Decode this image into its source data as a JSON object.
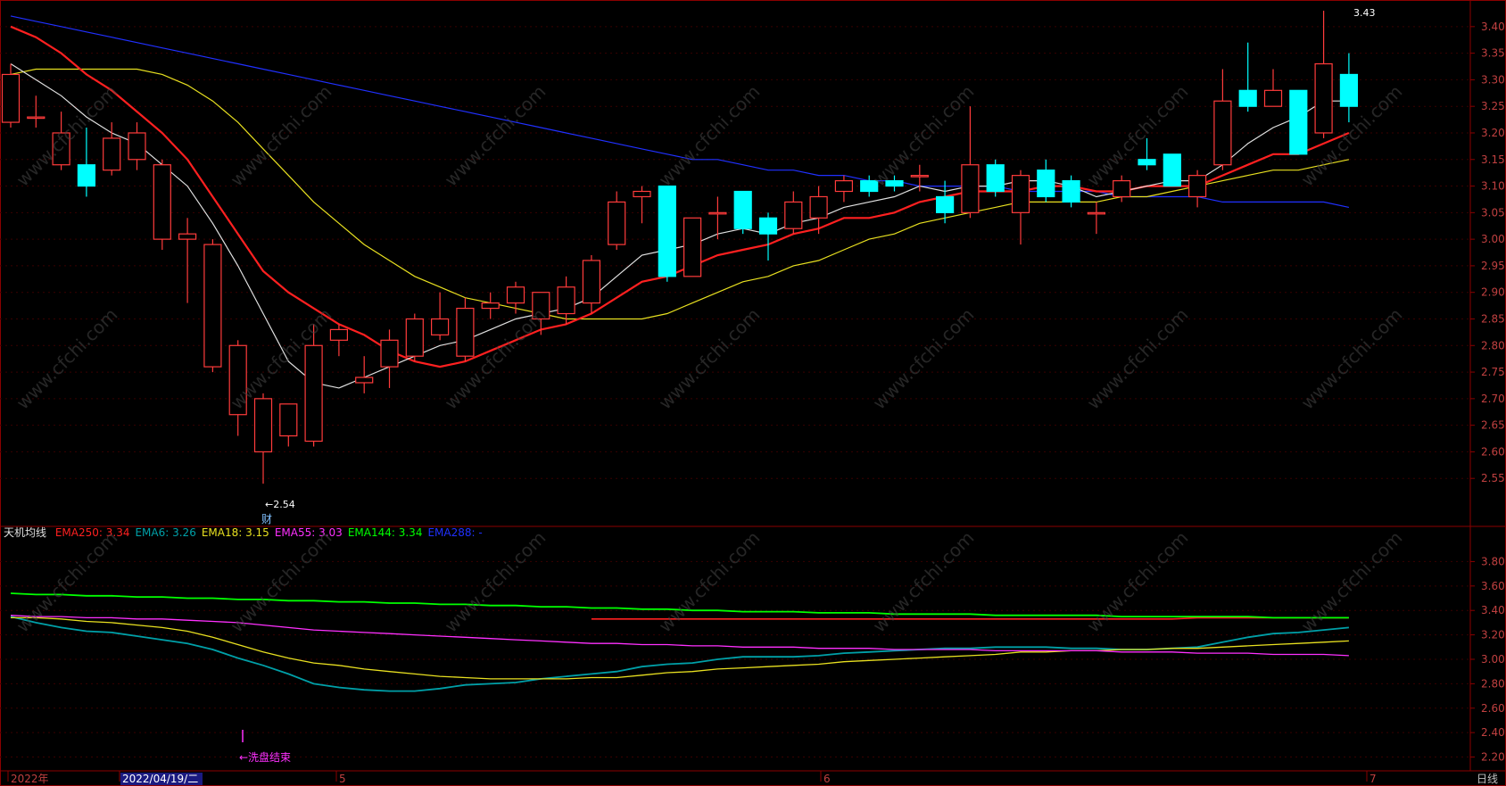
{
  "colors": {
    "background": "#000000",
    "frame": "#8b0000",
    "up_candle": "#ff3b3b",
    "down_candle": "#00ffff",
    "ema250": "#ff2020",
    "ema6": "#00a0a8",
    "ema18": "#e8e020",
    "ema55": "#ff30ff",
    "ema144": "#00ff00",
    "ema288": "#2030ff",
    "white_ma": "#e0e0e0"
  },
  "watermark": "www.cfchi.com",
  "main_chart": {
    "y_ticks": [
      "3.40",
      "3.35",
      "3.30",
      "3.25",
      "3.20",
      "3.15",
      "3.10",
      "3.05",
      "3.00",
      "2.95",
      "2.90",
      "2.85",
      "2.80",
      "2.75",
      "2.70",
      "2.65",
      "2.60",
      "2.55"
    ],
    "high_label": "3.43",
    "low_label": "←2.54",
    "low_marker": "财"
  },
  "indicator": {
    "name": "天机均线",
    "legend": [
      {
        "label": "EMA250:",
        "value": "3.34",
        "color": "#ff2020"
      },
      {
        "label": "EMA6:",
        "value": "3.26",
        "color": "#00a0a8"
      },
      {
        "label": "EMA18:",
        "value": "3.15",
        "color": "#e8e020"
      },
      {
        "label": "EMA55:",
        "value": "3.03",
        "color": "#ff30ff"
      },
      {
        "label": "EMA144:",
        "value": "3.34",
        "color": "#00ff00"
      },
      {
        "label": "EMA288:",
        "value": "-",
        "color": "#2030ff"
      }
    ],
    "y_ticks": [
      "3.80",
      "3.60",
      "3.40",
      "3.20",
      "3.00",
      "2.80",
      "2.60",
      "2.40",
      "2.20"
    ],
    "signal_label": "←洗盘结束"
  },
  "x_axis": {
    "labels": [
      "2022年",
      "2022/04/19/二",
      "5",
      "6",
      "7"
    ],
    "period": "日线"
  },
  "chart_data": [
    {
      "type": "candlestick",
      "ylim": [
        2.5,
        3.44
      ],
      "candles": [
        {
          "o": 3.22,
          "h": 3.33,
          "l": 3.21,
          "c": 3.31
        },
        {
          "o": 3.23,
          "h": 3.27,
          "l": 3.21,
          "c": 3.23
        },
        {
          "o": 3.14,
          "h": 3.24,
          "l": 3.13,
          "c": 3.2
        },
        {
          "o": 3.14,
          "h": 3.21,
          "l": 3.08,
          "c": 3.1
        },
        {
          "o": 3.13,
          "h": 3.22,
          "l": 3.12,
          "c": 3.19
        },
        {
          "o": 3.15,
          "h": 3.22,
          "l": 3.13,
          "c": 3.2
        },
        {
          "o": 3.0,
          "h": 3.15,
          "l": 2.98,
          "c": 3.14
        },
        {
          "o": 3.0,
          "h": 3.04,
          "l": 2.88,
          "c": 3.01
        },
        {
          "o": 2.76,
          "h": 3.0,
          "l": 2.75,
          "c": 2.99
        },
        {
          "o": 2.67,
          "h": 2.81,
          "l": 2.63,
          "c": 2.8
        },
        {
          "o": 2.6,
          "h": 2.71,
          "l": 2.54,
          "c": 2.7
        },
        {
          "o": 2.63,
          "h": 2.69,
          "l": 2.61,
          "c": 2.69
        },
        {
          "o": 2.62,
          "h": 2.84,
          "l": 2.61,
          "c": 2.8
        },
        {
          "o": 2.81,
          "h": 2.84,
          "l": 2.78,
          "c": 2.83
        },
        {
          "o": 2.73,
          "h": 2.78,
          "l": 2.71,
          "c": 2.74
        },
        {
          "o": 2.76,
          "h": 2.83,
          "l": 2.72,
          "c": 2.81
        },
        {
          "o": 2.78,
          "h": 2.86,
          "l": 2.77,
          "c": 2.85
        },
        {
          "o": 2.82,
          "h": 2.9,
          "l": 2.81,
          "c": 2.85
        },
        {
          "o": 2.78,
          "h": 2.89,
          "l": 2.77,
          "c": 2.87
        },
        {
          "o": 2.87,
          "h": 2.9,
          "l": 2.85,
          "c": 2.88
        },
        {
          "o": 2.88,
          "h": 2.92,
          "l": 2.86,
          "c": 2.91
        },
        {
          "o": 2.85,
          "h": 2.9,
          "l": 2.82,
          "c": 2.9
        },
        {
          "o": 2.86,
          "h": 2.93,
          "l": 2.84,
          "c": 2.91
        },
        {
          "o": 2.88,
          "h": 2.97,
          "l": 2.86,
          "c": 2.96
        },
        {
          "o": 2.99,
          "h": 3.09,
          "l": 2.98,
          "c": 3.07
        },
        {
          "o": 3.08,
          "h": 3.1,
          "l": 3.03,
          "c": 3.09
        },
        {
          "o": 3.1,
          "h": 3.1,
          "l": 2.92,
          "c": 2.93
        },
        {
          "o": 2.93,
          "h": 3.04,
          "l": 2.93,
          "c": 3.04
        },
        {
          "o": 3.05,
          "h": 3.08,
          "l": 3.0,
          "c": 3.05
        },
        {
          "o": 3.09,
          "h": 3.09,
          "l": 3.01,
          "c": 3.02
        },
        {
          "o": 3.04,
          "h": 3.05,
          "l": 2.96,
          "c": 3.01
        },
        {
          "o": 3.02,
          "h": 3.09,
          "l": 3.01,
          "c": 3.07
        },
        {
          "o": 3.04,
          "h": 3.1,
          "l": 3.01,
          "c": 3.08
        },
        {
          "o": 3.09,
          "h": 3.12,
          "l": 3.07,
          "c": 3.11
        },
        {
          "o": 3.11,
          "h": 3.12,
          "l": 3.08,
          "c": 3.09
        },
        {
          "o": 3.11,
          "h": 3.12,
          "l": 3.09,
          "c": 3.1
        },
        {
          "o": 3.12,
          "h": 3.14,
          "l": 3.09,
          "c": 3.12
        },
        {
          "o": 3.08,
          "h": 3.11,
          "l": 3.03,
          "c": 3.05
        },
        {
          "o": 3.05,
          "h": 3.25,
          "l": 3.04,
          "c": 3.14
        },
        {
          "o": 3.14,
          "h": 3.15,
          "l": 3.08,
          "c": 3.09
        },
        {
          "o": 3.05,
          "h": 3.13,
          "l": 2.99,
          "c": 3.12
        },
        {
          "o": 3.13,
          "h": 3.15,
          "l": 3.07,
          "c": 3.08
        },
        {
          "o": 3.11,
          "h": 3.12,
          "l": 3.06,
          "c": 3.07
        },
        {
          "o": 3.05,
          "h": 3.07,
          "l": 3.01,
          "c": 3.05
        },
        {
          "o": 3.08,
          "h": 3.12,
          "l": 3.07,
          "c": 3.11
        },
        {
          "o": 3.15,
          "h": 3.19,
          "l": 3.13,
          "c": 3.14
        },
        {
          "o": 3.16,
          "h": 3.16,
          "l": 3.1,
          "c": 3.1
        },
        {
          "o": 3.08,
          "h": 3.13,
          "l": 3.06,
          "c": 3.12
        },
        {
          "o": 3.14,
          "h": 3.32,
          "l": 3.13,
          "c": 3.26
        },
        {
          "o": 3.28,
          "h": 3.37,
          "l": 3.24,
          "c": 3.25
        },
        {
          "o": 3.25,
          "h": 3.32,
          "l": 3.25,
          "c": 3.28
        },
        {
          "o": 3.28,
          "h": 3.28,
          "l": 3.16,
          "c": 3.16
        },
        {
          "o": 3.2,
          "h": 3.43,
          "l": 3.19,
          "c": 3.33
        },
        {
          "o": 3.31,
          "h": 3.35,
          "l": 3.22,
          "c": 3.25
        }
      ],
      "ma_white": [
        3.33,
        3.3,
        3.27,
        3.23,
        3.2,
        3.18,
        3.14,
        3.1,
        3.03,
        2.95,
        2.86,
        2.77,
        2.73,
        2.72,
        2.74,
        2.76,
        2.78,
        2.8,
        2.81,
        2.83,
        2.85,
        2.86,
        2.87,
        2.89,
        2.93,
        2.97,
        2.98,
        2.99,
        3.01,
        3.02,
        3.01,
        3.03,
        3.04,
        3.06,
        3.07,
        3.08,
        3.1,
        3.09,
        3.1,
        3.1,
        3.11,
        3.11,
        3.1,
        3.08,
        3.09,
        3.1,
        3.11,
        3.11,
        3.14,
        3.18,
        3.21,
        3.23,
        3.26,
        3.26
      ],
      "ma_red": [
        3.4,
        3.38,
        3.35,
        3.31,
        3.28,
        3.24,
        3.2,
        3.15,
        3.08,
        3.01,
        2.94,
        2.9,
        2.87,
        2.84,
        2.82,
        2.79,
        2.77,
        2.76,
        2.77,
        2.79,
        2.81,
        2.83,
        2.84,
        2.86,
        2.89,
        2.92,
        2.93,
        2.95,
        2.97,
        2.98,
        2.99,
        3.01,
        3.02,
        3.04,
        3.04,
        3.05,
        3.07,
        3.08,
        3.09,
        3.09,
        3.09,
        3.1,
        3.1,
        3.09,
        3.09,
        3.1,
        3.1,
        3.1,
        3.12,
        3.14,
        3.16,
        3.16,
        3.18,
        3.2
      ],
      "ma_yellow": [
        3.31,
        3.32,
        3.32,
        3.32,
        3.32,
        3.32,
        3.31,
        3.29,
        3.26,
        3.22,
        3.17,
        3.12,
        3.07,
        3.03,
        2.99,
        2.96,
        2.93,
        2.91,
        2.89,
        2.88,
        2.87,
        2.86,
        2.85,
        2.85,
        2.85,
        2.85,
        2.86,
        2.88,
        2.9,
        2.92,
        2.93,
        2.95,
        2.96,
        2.98,
        3.0,
        3.01,
        3.03,
        3.04,
        3.05,
        3.06,
        3.07,
        3.07,
        3.07,
        3.07,
        3.08,
        3.08,
        3.09,
        3.1,
        3.11,
        3.12,
        3.13,
        3.13,
        3.14,
        3.15
      ],
      "ma_blue": [
        3.42,
        3.41,
        3.4,
        3.39,
        3.38,
        3.37,
        3.36,
        3.35,
        3.34,
        3.33,
        3.32,
        3.31,
        3.3,
        3.29,
        3.28,
        3.27,
        3.26,
        3.25,
        3.24,
        3.23,
        3.22,
        3.21,
        3.2,
        3.19,
        3.18,
        3.17,
        3.16,
        3.15,
        3.15,
        3.14,
        3.13,
        3.13,
        3.12,
        3.12,
        3.11,
        3.11,
        3.1,
        3.1,
        3.1,
        3.1,
        3.09,
        3.09,
        3.09,
        3.09,
        3.08,
        3.08,
        3.08,
        3.08,
        3.07,
        3.07,
        3.07,
        3.07,
        3.07,
        3.06
      ]
    },
    {
      "type": "line",
      "ylim": [
        2.16,
        3.92
      ],
      "series": [
        {
          "name": "EMA250",
          "start": 23,
          "values": [
            3.33,
            3.33,
            3.33,
            3.33,
            3.33,
            3.33,
            3.33,
            3.33,
            3.33,
            3.33,
            3.33,
            3.33,
            3.33,
            3.33,
            3.33,
            3.33,
            3.33,
            3.33,
            3.33,
            3.33,
            3.33,
            3.33,
            3.33,
            3.33,
            3.34,
            3.34,
            3.34,
            3.34,
            3.34,
            3.34,
            3.34
          ]
        },
        {
          "name": "EMA6",
          "start": 0,
          "values": [
            3.35,
            3.3,
            3.26,
            3.23,
            3.22,
            3.19,
            3.16,
            3.13,
            3.08,
            3.01,
            2.95,
            2.88,
            2.8,
            2.77,
            2.75,
            2.74,
            2.74,
            2.76,
            2.79,
            2.8,
            2.81,
            2.84,
            2.86,
            2.88,
            2.9,
            2.94,
            2.96,
            2.97,
            3.0,
            3.02,
            3.02,
            3.02,
            3.03,
            3.05,
            3.06,
            3.07,
            3.08,
            3.09,
            3.09,
            3.1,
            3.1,
            3.1,
            3.09,
            3.09,
            3.08,
            3.08,
            3.09,
            3.1,
            3.14,
            3.18,
            3.21,
            3.22,
            3.24,
            3.26
          ]
        },
        {
          "name": "EMA18",
          "start": 0,
          "values": [
            3.34,
            3.34,
            3.33,
            3.31,
            3.3,
            3.28,
            3.26,
            3.23,
            3.18,
            3.12,
            3.06,
            3.01,
            2.97,
            2.95,
            2.92,
            2.9,
            2.88,
            2.86,
            2.85,
            2.84,
            2.84,
            2.84,
            2.84,
            2.85,
            2.85,
            2.87,
            2.89,
            2.9,
            2.92,
            2.93,
            2.94,
            2.95,
            2.96,
            2.98,
            2.99,
            3.0,
            3.01,
            3.02,
            3.03,
            3.04,
            3.06,
            3.06,
            3.07,
            3.07,
            3.08,
            3.08,
            3.09,
            3.09,
            3.1,
            3.11,
            3.12,
            3.13,
            3.14,
            3.15
          ]
        },
        {
          "name": "EMA55",
          "start": 0,
          "values": [
            3.36,
            3.35,
            3.35,
            3.34,
            3.34,
            3.33,
            3.33,
            3.32,
            3.31,
            3.3,
            3.28,
            3.26,
            3.24,
            3.23,
            3.22,
            3.21,
            3.2,
            3.19,
            3.18,
            3.17,
            3.16,
            3.15,
            3.14,
            3.13,
            3.13,
            3.12,
            3.12,
            3.11,
            3.11,
            3.1,
            3.1,
            3.1,
            3.09,
            3.09,
            3.09,
            3.08,
            3.08,
            3.08,
            3.08,
            3.07,
            3.07,
            3.07,
            3.07,
            3.07,
            3.06,
            3.06,
            3.06,
            3.05,
            3.05,
            3.05,
            3.04,
            3.04,
            3.04,
            3.03
          ]
        },
        {
          "name": "EMA144",
          "start": 0,
          "values": [
            3.54,
            3.53,
            3.53,
            3.52,
            3.52,
            3.51,
            3.51,
            3.5,
            3.5,
            3.49,
            3.49,
            3.48,
            3.48,
            3.47,
            3.47,
            3.46,
            3.46,
            3.45,
            3.45,
            3.44,
            3.44,
            3.43,
            3.43,
            3.42,
            3.42,
            3.41,
            3.41,
            3.4,
            3.4,
            3.39,
            3.39,
            3.39,
            3.38,
            3.38,
            3.38,
            3.37,
            3.37,
            3.37,
            3.37,
            3.36,
            3.36,
            3.36,
            3.36,
            3.36,
            3.35,
            3.35,
            3.35,
            3.35,
            3.35,
            3.35,
            3.34,
            3.34,
            3.34,
            3.34
          ]
        }
      ]
    }
  ]
}
